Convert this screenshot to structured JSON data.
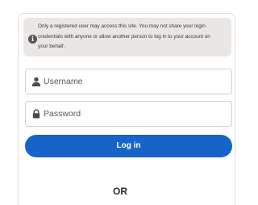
{
  "notice": {
    "icon": "info-icon",
    "icon_glyph": "i",
    "line1": "Only a registered user may access this site. You may not share your login",
    "line2": "credentials with anyone or allow another person to log in to your account on",
    "line3": "your behalf."
  },
  "form": {
    "username": {
      "icon": "user-icon",
      "placeholder": "Username",
      "value": ""
    },
    "password": {
      "icon": "lock-icon",
      "placeholder": "Password",
      "value": ""
    },
    "login_label": "Log in",
    "divider_label": "OR"
  },
  "colors": {
    "primary": "#1764c9",
    "notice_bg": "#e9e6e3",
    "text": "#2b2b2b"
  }
}
